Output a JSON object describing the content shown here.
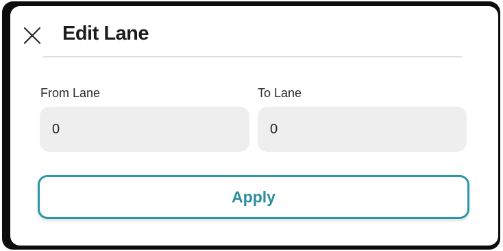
{
  "dialog": {
    "title": "Edit Lane",
    "close_icon": "close-icon"
  },
  "fields": {
    "from": {
      "label": "From Lane",
      "value": "0"
    },
    "to": {
      "label": "To Lane",
      "value": "0"
    }
  },
  "actions": {
    "apply_label": "Apply"
  },
  "colors": {
    "accent": "#2b96a5",
    "field_bg": "#eeeeee",
    "frame": "#0d0d0d"
  }
}
